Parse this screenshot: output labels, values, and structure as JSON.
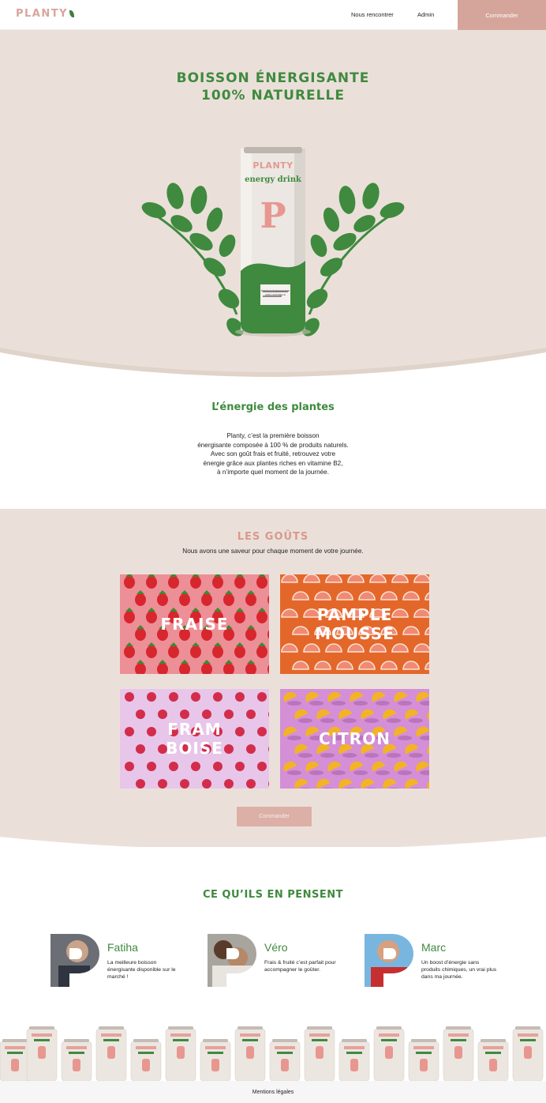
{
  "header": {
    "logo": "PLANTY",
    "nav": [
      "Nous rencontrer",
      "Admin"
    ],
    "cta": "Commander"
  },
  "hero": {
    "title_line1": "BOISSON ÉNERGISANTE",
    "title_line2": "100% NATURELLE",
    "can_brand": "PLANTY",
    "can_subtitle": "energy drink",
    "can_letter": "P",
    "can_label": "BOISSON ÉNERGISANTE 100% NATURELLE"
  },
  "energy": {
    "title": "L’énergie des plantes",
    "lines": [
      "Planty, c’est la première boisson",
      "énergisante composée à 100 % de produits naturels.",
      "Avec son goût frais et fruité, retrouvez votre",
      "énergie grâce aux plantes riches en vitamine B2,",
      "à n’importe quel moment de la journée."
    ]
  },
  "flavours": {
    "title": "LES GOÛTS",
    "subtitle": "Nous avons une saveur pour chaque moment de votre journée.",
    "items": [
      {
        "line1": "FRAISE",
        "line2": "",
        "bg": "#ec8f97",
        "fruit": "#d8262e"
      },
      {
        "line1": "PAMPLE",
        "line2": "MOUSSE",
        "bg": "#e4672a",
        "fruit": "#f08a72"
      },
      {
        "line1": "FRAM",
        "line2": "BOISE",
        "bg": "#e7c6ea",
        "fruit": "#d22d4a"
      },
      {
        "line1": "CITRON",
        "line2": "",
        "bg": "#d48fd6",
        "fruit": "#f2b425"
      }
    ],
    "cta": "Commander"
  },
  "testimonials": {
    "title": "CE QU’ILS EN PENSENT",
    "people": [
      {
        "name": "Fatiha",
        "quote": "La meilleure boisson énergisante disponible sur le marché !"
      },
      {
        "name": "Véro",
        "quote": "Frais & fruité c’est parfait pour accompagner le goûter."
      },
      {
        "name": "Marc",
        "quote": "Un boost d’énergie sans produits chimiques, un vrai plus dans ma journée."
      }
    ]
  },
  "footer": {
    "legal": "Mentions légales"
  },
  "colors": {
    "brand_green": "#3f8a3f",
    "brand_pink": "#d5a59b",
    "beige": "#ebe0d9"
  }
}
